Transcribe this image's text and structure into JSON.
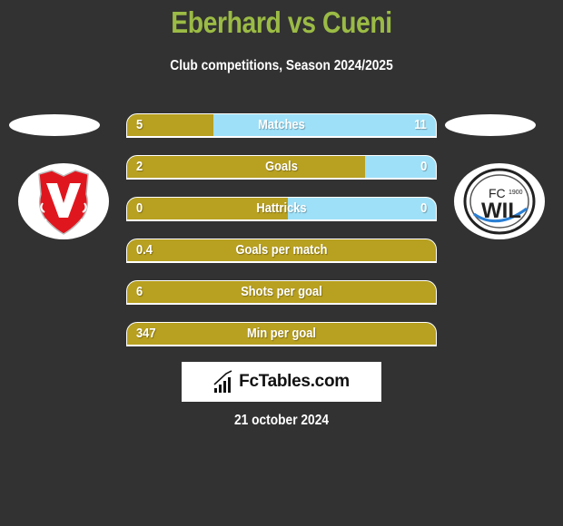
{
  "header": {
    "title": "Eberhard vs Cueni",
    "subtitle": "Club competitions, Season 2024/2025"
  },
  "teams": {
    "left": {
      "logo_icon": "vaduz-shield-logo"
    },
    "right": {
      "logo_icon": "fc-wil-1900-logo"
    }
  },
  "colors": {
    "left_fill": "#b8a020",
    "right_fill": "#9ee0f8",
    "title": "#9bbb45",
    "background": "#323232"
  },
  "stats": [
    {
      "label": "Matches",
      "left": "5",
      "right": "11",
      "left_share": 0.28
    },
    {
      "label": "Goals",
      "left": "2",
      "right": "0",
      "left_share": 0.77
    },
    {
      "label": "Hattricks",
      "left": "0",
      "right": "0",
      "left_share": 0.52
    },
    {
      "label": "Goals per match",
      "left": "0.4",
      "right": "",
      "left_share": 1.0
    },
    {
      "label": "Shots per goal",
      "left": "6",
      "right": "",
      "left_share": 1.0
    },
    {
      "label": "Min per goal",
      "left": "347",
      "right": "",
      "left_share": 1.0
    }
  ],
  "brand": {
    "name": "FcTables.com",
    "icon": "bar-chart-icon"
  },
  "footer": {
    "date": "21 october 2024"
  }
}
